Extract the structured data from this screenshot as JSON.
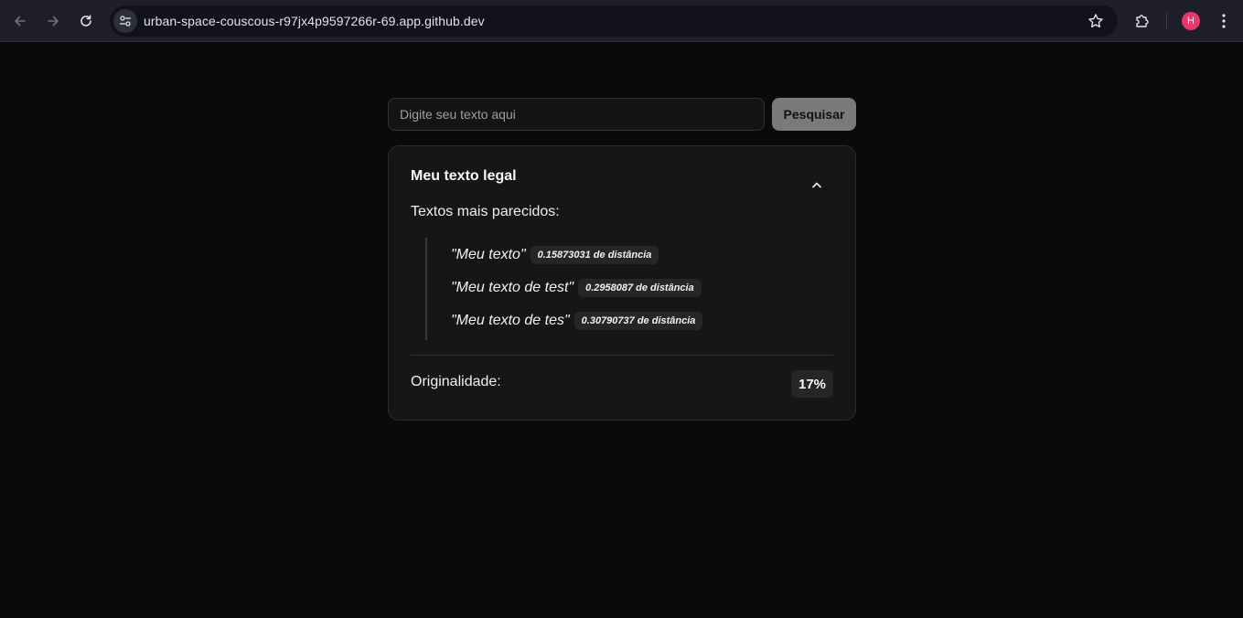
{
  "browser": {
    "url": "urban-space-couscous-r97jx4p9597266r-69.app.github.dev",
    "avatar_initial": "H",
    "avatar_color": "#e8376e"
  },
  "search": {
    "placeholder": "Digite seu texto aqui",
    "value": "",
    "button_label": "Pesquisar"
  },
  "result": {
    "title": "Meu texto legal",
    "similar_label": "Textos mais parecidos:",
    "similar_texts": [
      {
        "text": "\"Meu texto\"",
        "distance": "0.15873031 de distância"
      },
      {
        "text": "\"Meu texto de test\"",
        "distance": "0.2958087 de distância"
      },
      {
        "text": "\"Meu texto de tes\"",
        "distance": "0.30790737 de distância"
      }
    ],
    "originality_label": "Originalidade:",
    "originality_value": "17%"
  }
}
